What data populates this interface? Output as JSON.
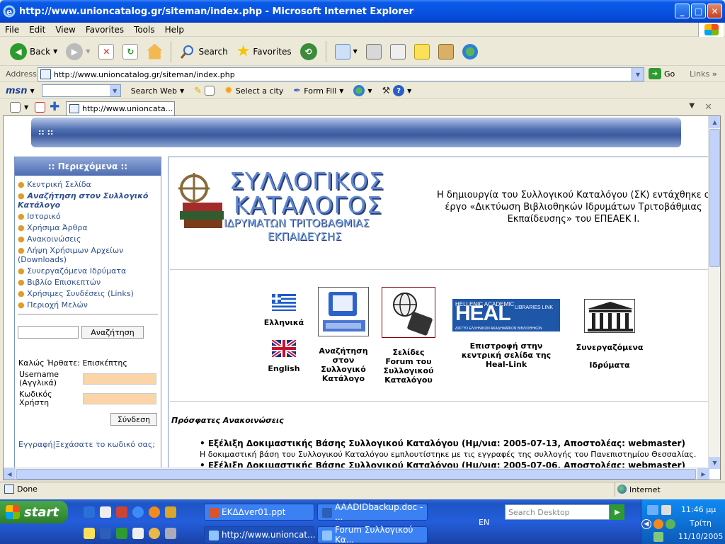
{
  "window": {
    "title": "http://www.unioncatalog.gr/siteman/index.php - Microsoft Internet Explorer"
  },
  "menu": [
    "File",
    "Edit",
    "View",
    "Favorites",
    "Tools",
    "Help"
  ],
  "toolbar": {
    "back": "Back",
    "search": "Search",
    "favorites": "Favorites"
  },
  "address": {
    "label": "Address",
    "url": "http://www.unioncatalog.gr/siteman/index.php",
    "go": "Go",
    "links": "Links"
  },
  "msnbar": {
    "logo": "msn",
    "search_web": "Search Web",
    "select_city": "Select a city",
    "form_fill": "Form Fill"
  },
  "tab": {
    "title": "http://www.unioncata..."
  },
  "page": {
    "banner": ":: ::",
    "sidebar": {
      "heading": ":: Περιεχόμενα ::",
      "items": [
        "Κεντρική Σελίδα",
        "Αναζήτηση στον Συλλογικό Κατάλογο",
        "Ιστορικό",
        "Χρήσιμα Άρθρα",
        "Ανακοινώσεις",
        "Λήψη Χρήσιμων Αρχείων (Downloads)",
        "Συνεργαζόμενα Ιδρύματα",
        "Βιβλίο Επισκεπτών",
        "Χρήσιμες Συνδέσεις (Links)",
        "Περιοχή Μελών"
      ],
      "search_button": "Αναζήτηση",
      "welcome": "Καλώς Ήρθατε: Επισκέπτης",
      "username_label": "Username (Αγγλικά)",
      "password_label": "Κωδικός Χρήστη",
      "login_button": "Σύνδεση",
      "register": "Εγγραφή",
      "separator": "|",
      "forgot": "Ξεχάσατε το κωδικό σας;"
    },
    "logo": {
      "line1": "ΣΥΛΛΟΓΙΚΟΣ",
      "line2": "ΚΑΤΑΛΟΓΟΣ",
      "line3": "ΙΔΡΥΜΑΤΩΝ ΤΡΙΤΟΒΑΘΜΙΑΣ",
      "line4": "ΕΚΠΑΙΔΕΥΣΗΣ"
    },
    "intro": "Η δημιουργία του Συλλογικού Καταλόγου (ΣΚ) εντάχθηκε σ έργο «Δικτύωση Βιβλιοθηκών Ιδρυμάτων Τριτοβάθμιας Εκπαίδευσης» του ΕΠΕΑΕΚ Ι.",
    "icons": {
      "greek": "Ελληνικά",
      "english": "English",
      "search_catalog": "Αναζήτηση στον Συλλογικό Κατάλογο",
      "forum": "Σελίδες Forum του Συλλογικού Καταλόγου",
      "heal_link": "Επιστροφή στην κεντρική σελίδα της Heal-Link",
      "heal_top": "HELLENIC ACADEMIC",
      "heal_big": "HEAL",
      "heal_right": "LIBRARIES LINK",
      "heal_bottom": "ΔΙΚΤΥΟ ΕΛΛΗΝΙΚΩΝ ΑΚΑΔΗΜΑΪΚΩΝ ΒΙΒΛΙΟΘΗΚΩΝ",
      "institutions1": "Συνεργαζόμενα",
      "institutions2": "Ιδρύματα"
    },
    "news": {
      "heading": "Πρόσφατες Ανακοινώσεις",
      "item1": "Εξέλιξη Δοκιμαστικής Βάσης Συλλογικού Καταλόγου (Ημ/νια: 2005-07-13, Αποστολέας: webmaster)",
      "item1_desc": "Η δοκιμαστική βάση του Συλλογικού Καταλόγου εμπλουτίστηκε με τις εγγραφές της συλλογής του Πανεπιστημίου Θεσσαλίας.",
      "item2": "Εξέλιξη Δοκιμαστικής Βάσης Συλλογικού Καταλόγου (Ημ/νια: 2005-07-06, Αποστολέας: webmaster)"
    }
  },
  "status": {
    "text": "Done",
    "zone": "Internet"
  },
  "taskbar": {
    "start": "start",
    "items": [
      "ΕΚΔΔver01.ppt",
      "AAADIDbackup.doc - ...",
      "http://www.unioncat...",
      "Forum Συλλογικού Κα..."
    ],
    "search_placeholder": "Search Desktop",
    "lang": "EN",
    "time": "11:46 μμ",
    "day": "Τρίτη",
    "date": "11/10/2005"
  },
  "colors": {
    "xp_blue": "#0754e0",
    "sidebar_link": "#2f4f8f",
    "login_field": "#fbd5a8",
    "start_green": "#3b963b"
  }
}
